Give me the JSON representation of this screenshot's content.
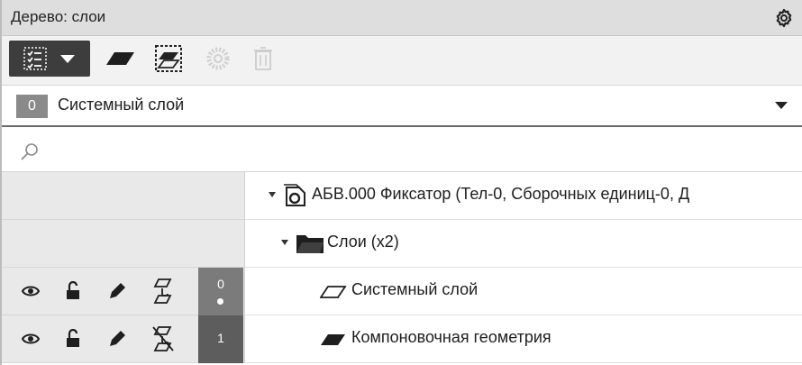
{
  "panel": {
    "title": "Дерево: слои",
    "settings_icon": "gear-icon"
  },
  "toolbar": {
    "buttons": [
      {
        "name": "layer-filter",
        "icon": "checklist-icon",
        "enabled": true
      },
      {
        "name": "new-layer",
        "icon": "layer-icon",
        "enabled": true
      },
      {
        "name": "select-layer",
        "icon": "dashed-layer-icon",
        "enabled": true
      },
      {
        "name": "layer-settings",
        "icon": "gear-dotted-icon",
        "enabled": false
      },
      {
        "name": "delete-layer",
        "icon": "trash-icon",
        "enabled": false
      }
    ]
  },
  "current_layer": {
    "number": "0",
    "name": "Системный слой"
  },
  "search": {
    "placeholder": "",
    "value": ""
  },
  "tree": {
    "root": {
      "label": "АБВ.000 Фиксатор (Тел-0, Сборочных единиц-0, Д"
    },
    "folder": {
      "label": "Слои (x2)"
    },
    "layers": [
      {
        "number": "0",
        "name": "Системный слой",
        "current": true,
        "visible": true,
        "locked": false,
        "editable": true,
        "printable": true
      },
      {
        "number": "1",
        "name": "Компоновочная геометрия",
        "current": false,
        "visible": true,
        "locked": false,
        "editable": true,
        "printable": false
      }
    ]
  },
  "colors": {
    "titlebar": "#dedede",
    "toolbar_active": "#3d3d3d",
    "layer_badge": "#8a8a8a",
    "row_left": "#e9e9e9"
  }
}
